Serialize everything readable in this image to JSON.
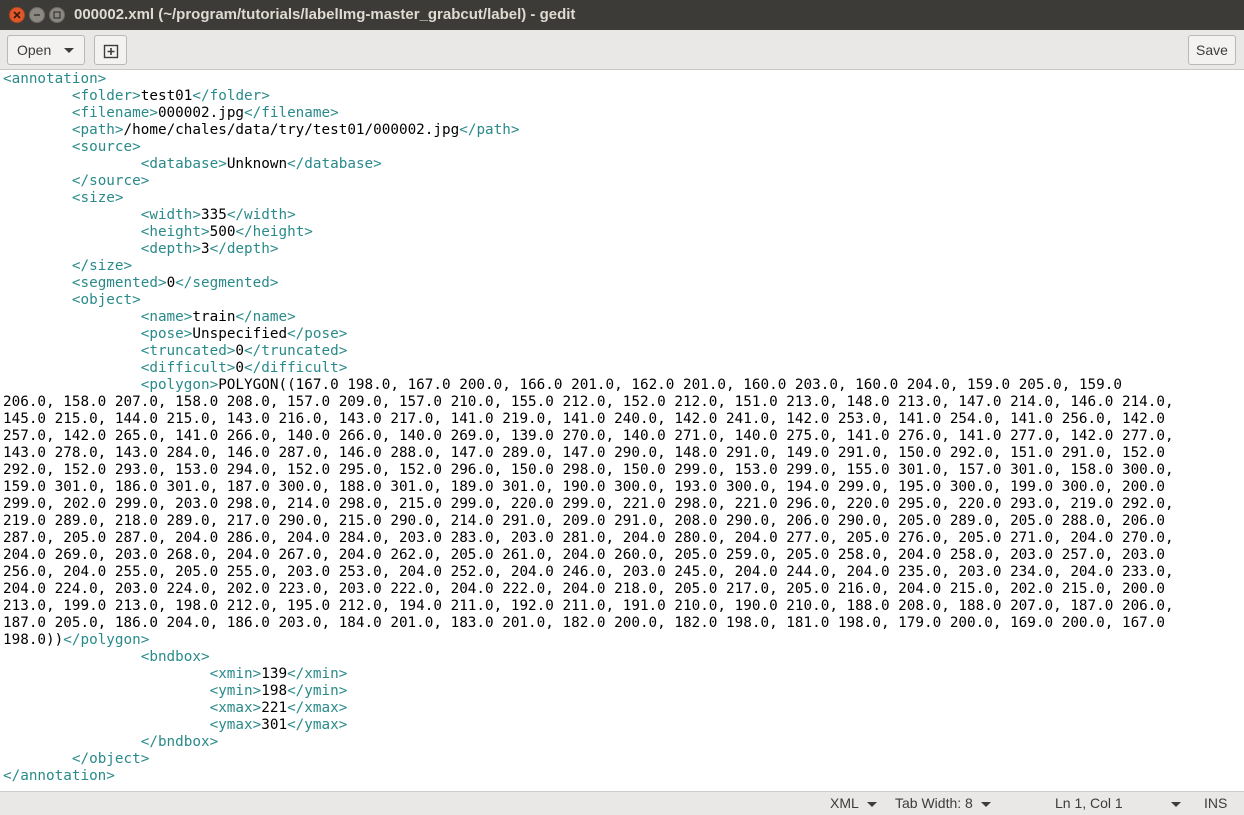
{
  "window": {
    "title": "000002.xml (~/program/tutorials/labelImg-master_grabcut/label) - gedit"
  },
  "toolbar": {
    "open_label": "Open",
    "save_label": "Save",
    "new_tab_icon": "new-tab-icon"
  },
  "editor": {
    "language": "XML",
    "tag_color": "#2a8a8a",
    "lines": [
      "<annotation>",
      "\t<folder>test01</folder>",
      "\t<filename>000002.jpg</filename>",
      "\t<path>/home/chales/data/try/test01/000002.jpg</path>",
      "\t<source>",
      "\t\t<database>Unknown</database>",
      "\t</source>",
      "\t<size>",
      "\t\t<width>335</width>",
      "\t\t<height>500</height>",
      "\t\t<depth>3</depth>",
      "\t</size>",
      "\t<segmented>0</segmented>",
      "\t<object>",
      "\t\t<name>train</name>",
      "\t\t<pose>Unspecified</pose>",
      "\t\t<truncated>0</truncated>",
      "\t\t<difficult>0</difficult>",
      "\t\t<polygon>POLYGON((167.0 198.0, 167.0 200.0, 166.0 201.0, 162.0 201.0, 160.0 203.0, 160.0 204.0, 159.0 205.0, 159.0",
      "206.0, 158.0 207.0, 158.0 208.0, 157.0 209.0, 157.0 210.0, 155.0 212.0, 152.0 212.0, 151.0 213.0, 148.0 213.0, 147.0 214.0, 146.0 214.0,",
      "145.0 215.0, 144.0 215.0, 143.0 216.0, 143.0 217.0, 141.0 219.0, 141.0 240.0, 142.0 241.0, 142.0 253.0, 141.0 254.0, 141.0 256.0, 142.0",
      "257.0, 142.0 265.0, 141.0 266.0, 140.0 266.0, 140.0 269.0, 139.0 270.0, 140.0 271.0, 140.0 275.0, 141.0 276.0, 141.0 277.0, 142.0 277.0,",
      "143.0 278.0, 143.0 284.0, 146.0 287.0, 146.0 288.0, 147.0 289.0, 147.0 290.0, 148.0 291.0, 149.0 291.0, 150.0 292.0, 151.0 291.0, 152.0",
      "292.0, 152.0 293.0, 153.0 294.0, 152.0 295.0, 152.0 296.0, 150.0 298.0, 150.0 299.0, 153.0 299.0, 155.0 301.0, 157.0 301.0, 158.0 300.0,",
      "159.0 301.0, 186.0 301.0, 187.0 300.0, 188.0 301.0, 189.0 301.0, 190.0 300.0, 193.0 300.0, 194.0 299.0, 195.0 300.0, 199.0 300.0, 200.0",
      "299.0, 202.0 299.0, 203.0 298.0, 214.0 298.0, 215.0 299.0, 220.0 299.0, 221.0 298.0, 221.0 296.0, 220.0 295.0, 220.0 293.0, 219.0 292.0,",
      "219.0 289.0, 218.0 289.0, 217.0 290.0, 215.0 290.0, 214.0 291.0, 209.0 291.0, 208.0 290.0, 206.0 290.0, 205.0 289.0, 205.0 288.0, 206.0",
      "287.0, 205.0 287.0, 204.0 286.0, 204.0 284.0, 203.0 283.0, 203.0 281.0, 204.0 280.0, 204.0 277.0, 205.0 276.0, 205.0 271.0, 204.0 270.0,",
      "204.0 269.0, 203.0 268.0, 204.0 267.0, 204.0 262.0, 205.0 261.0, 204.0 260.0, 205.0 259.0, 205.0 258.0, 204.0 258.0, 203.0 257.0, 203.0",
      "256.0, 204.0 255.0, 205.0 255.0, 203.0 253.0, 204.0 252.0, 204.0 246.0, 203.0 245.0, 204.0 244.0, 204.0 235.0, 203.0 234.0, 204.0 233.0,",
      "204.0 224.0, 203.0 224.0, 202.0 223.0, 203.0 222.0, 204.0 222.0, 204.0 218.0, 205.0 217.0, 205.0 216.0, 204.0 215.0, 202.0 215.0, 200.0",
      "213.0, 199.0 213.0, 198.0 212.0, 195.0 212.0, 194.0 211.0, 192.0 211.0, 191.0 210.0, 190.0 210.0, 188.0 208.0, 188.0 207.0, 187.0 206.0,",
      "187.0 205.0, 186.0 204.0, 186.0 203.0, 184.0 201.0, 183.0 201.0, 182.0 200.0, 182.0 198.0, 181.0 198.0, 179.0 200.0, 169.0 200.0, 167.0",
      "198.0))</polygon>",
      "\t\t<bndbox>",
      "\t\t\t<xmin>139</xmin>",
      "\t\t\t<ymin>198</ymin>",
      "\t\t\t<xmax>221</xmax>",
      "\t\t\t<ymax>301</ymax>",
      "\t\t</bndbox>",
      "\t</object>",
      "</annotation>"
    ]
  },
  "statusbar": {
    "language": "XML",
    "tab_width": "Tab Width: 8",
    "position": "Ln 1, Col 1",
    "mode": "INS"
  }
}
